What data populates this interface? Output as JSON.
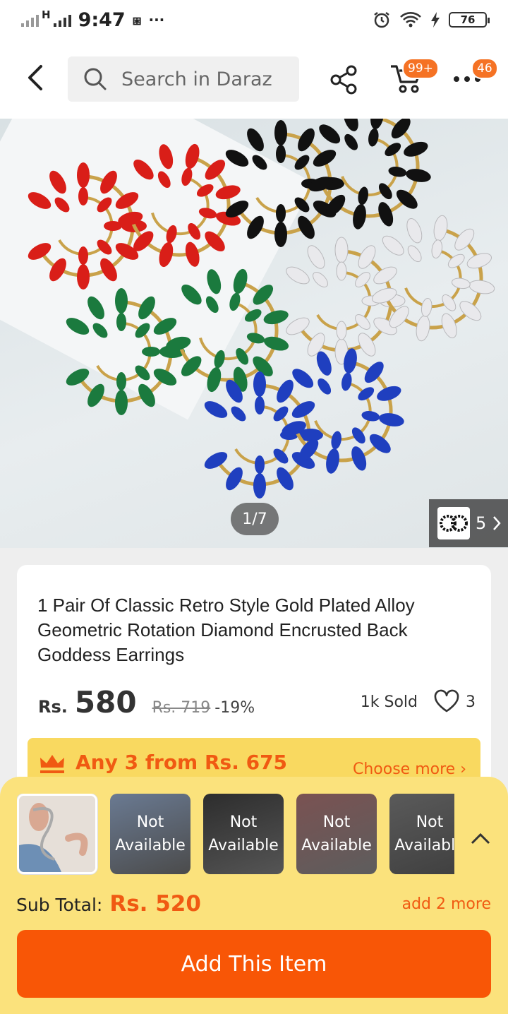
{
  "status_bar": {
    "time": "9:47",
    "network": "H",
    "battery": "76",
    "overflow": "···"
  },
  "header": {
    "search_placeholder": "Search in Daraz",
    "cart_badge": "99+",
    "more_badge": "46"
  },
  "gallery": {
    "counter": "1/7",
    "variant_count": "5"
  },
  "product": {
    "title": "1 Pair Of Classic Retro Style Gold Plated Alloy Geometric Rotation Diamond Encrusted Back Goddess Earrings",
    "currency": "Rs.",
    "price": "580",
    "old_price": "Rs. 719",
    "discount": "-19%",
    "sold": "1k Sold",
    "wishlist_count": "3"
  },
  "promo": {
    "text": "Any 3 from Rs. 675",
    "choose_more": "Choose more"
  },
  "bundle": {
    "items": [
      {
        "label_1": "",
        "label_2": ""
      },
      {
        "label_1": "Not",
        "label_2": "Available"
      },
      {
        "label_1": "Not",
        "label_2": "Available"
      },
      {
        "label_1": "Not",
        "label_2": "Available"
      },
      {
        "label_1": "Not",
        "label_2": "Available"
      }
    ],
    "subtotal_label": "Sub Total:",
    "subtotal_amount": "Rs. 520",
    "add_more": "add 2 more",
    "add_button": "Add This Item"
  },
  "colors": {
    "brand_orange": "#f85606",
    "promo_yellow": "#f9d960",
    "panel_yellow": "#fbe27c",
    "earring_colors": [
      "#d91e18",
      "#111111",
      "#1b7a3e",
      "#e9e9ec",
      "#1f3fbf"
    ]
  }
}
